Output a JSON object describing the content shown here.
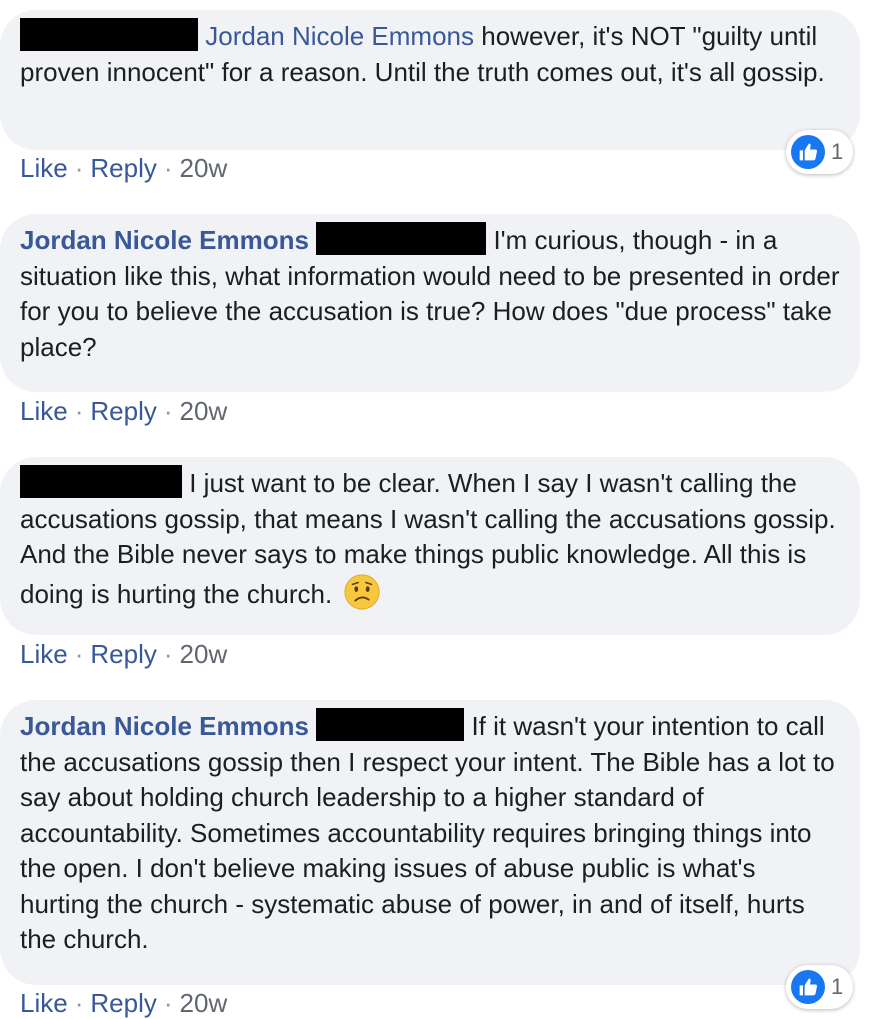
{
  "comments": [
    {
      "author": "Jordan Nicole Emmons",
      "text": "however, it's NOT \"guilty until proven innocent\" for a reason. Until the truth comes out, it's all gossip.",
      "actions": {
        "like": "Like",
        "reply": "Reply",
        "time": "20w"
      },
      "reaction": {
        "icon": "thumbs-up-icon",
        "count": "1"
      }
    },
    {
      "author": "Jordan Nicole Emmons",
      "text": "I'm curious, though - in a situation like this, what information would need to be presented in order for you to believe the accusation is true? How does \"due process\" take place?",
      "actions": {
        "like": "Like",
        "reply": "Reply",
        "time": "20w"
      }
    },
    {
      "text": "I just want to be clear. When I say I wasn't calling the accusations gossip, that means I wasn't calling the accusations gossip. And the Bible never says to make things public knowledge. All this is doing is hurting the church.",
      "emoji": "worried-face-icon",
      "actions": {
        "like": "Like",
        "reply": "Reply",
        "time": "20w"
      }
    },
    {
      "author": "Jordan Nicole Emmons",
      "text": "If it wasn't your intention to call the accusations gossip then I respect your intent. The Bible has a lot to say about holding church leadership to a higher standard of accountability. Sometimes accountability requires bringing things into the open. I don't believe making issues of abuse public is what's hurting the church - systematic abuse of power, in and of itself, hurts the church.",
      "actions": {
        "like": "Like",
        "reply": "Reply",
        "time": "20w"
      },
      "reaction": {
        "icon": "thumbs-up-icon",
        "count": "1"
      }
    }
  ],
  "colors": {
    "link": "#385898",
    "bubble": "#f0f2f5",
    "like_blue": "#1877f2"
  }
}
